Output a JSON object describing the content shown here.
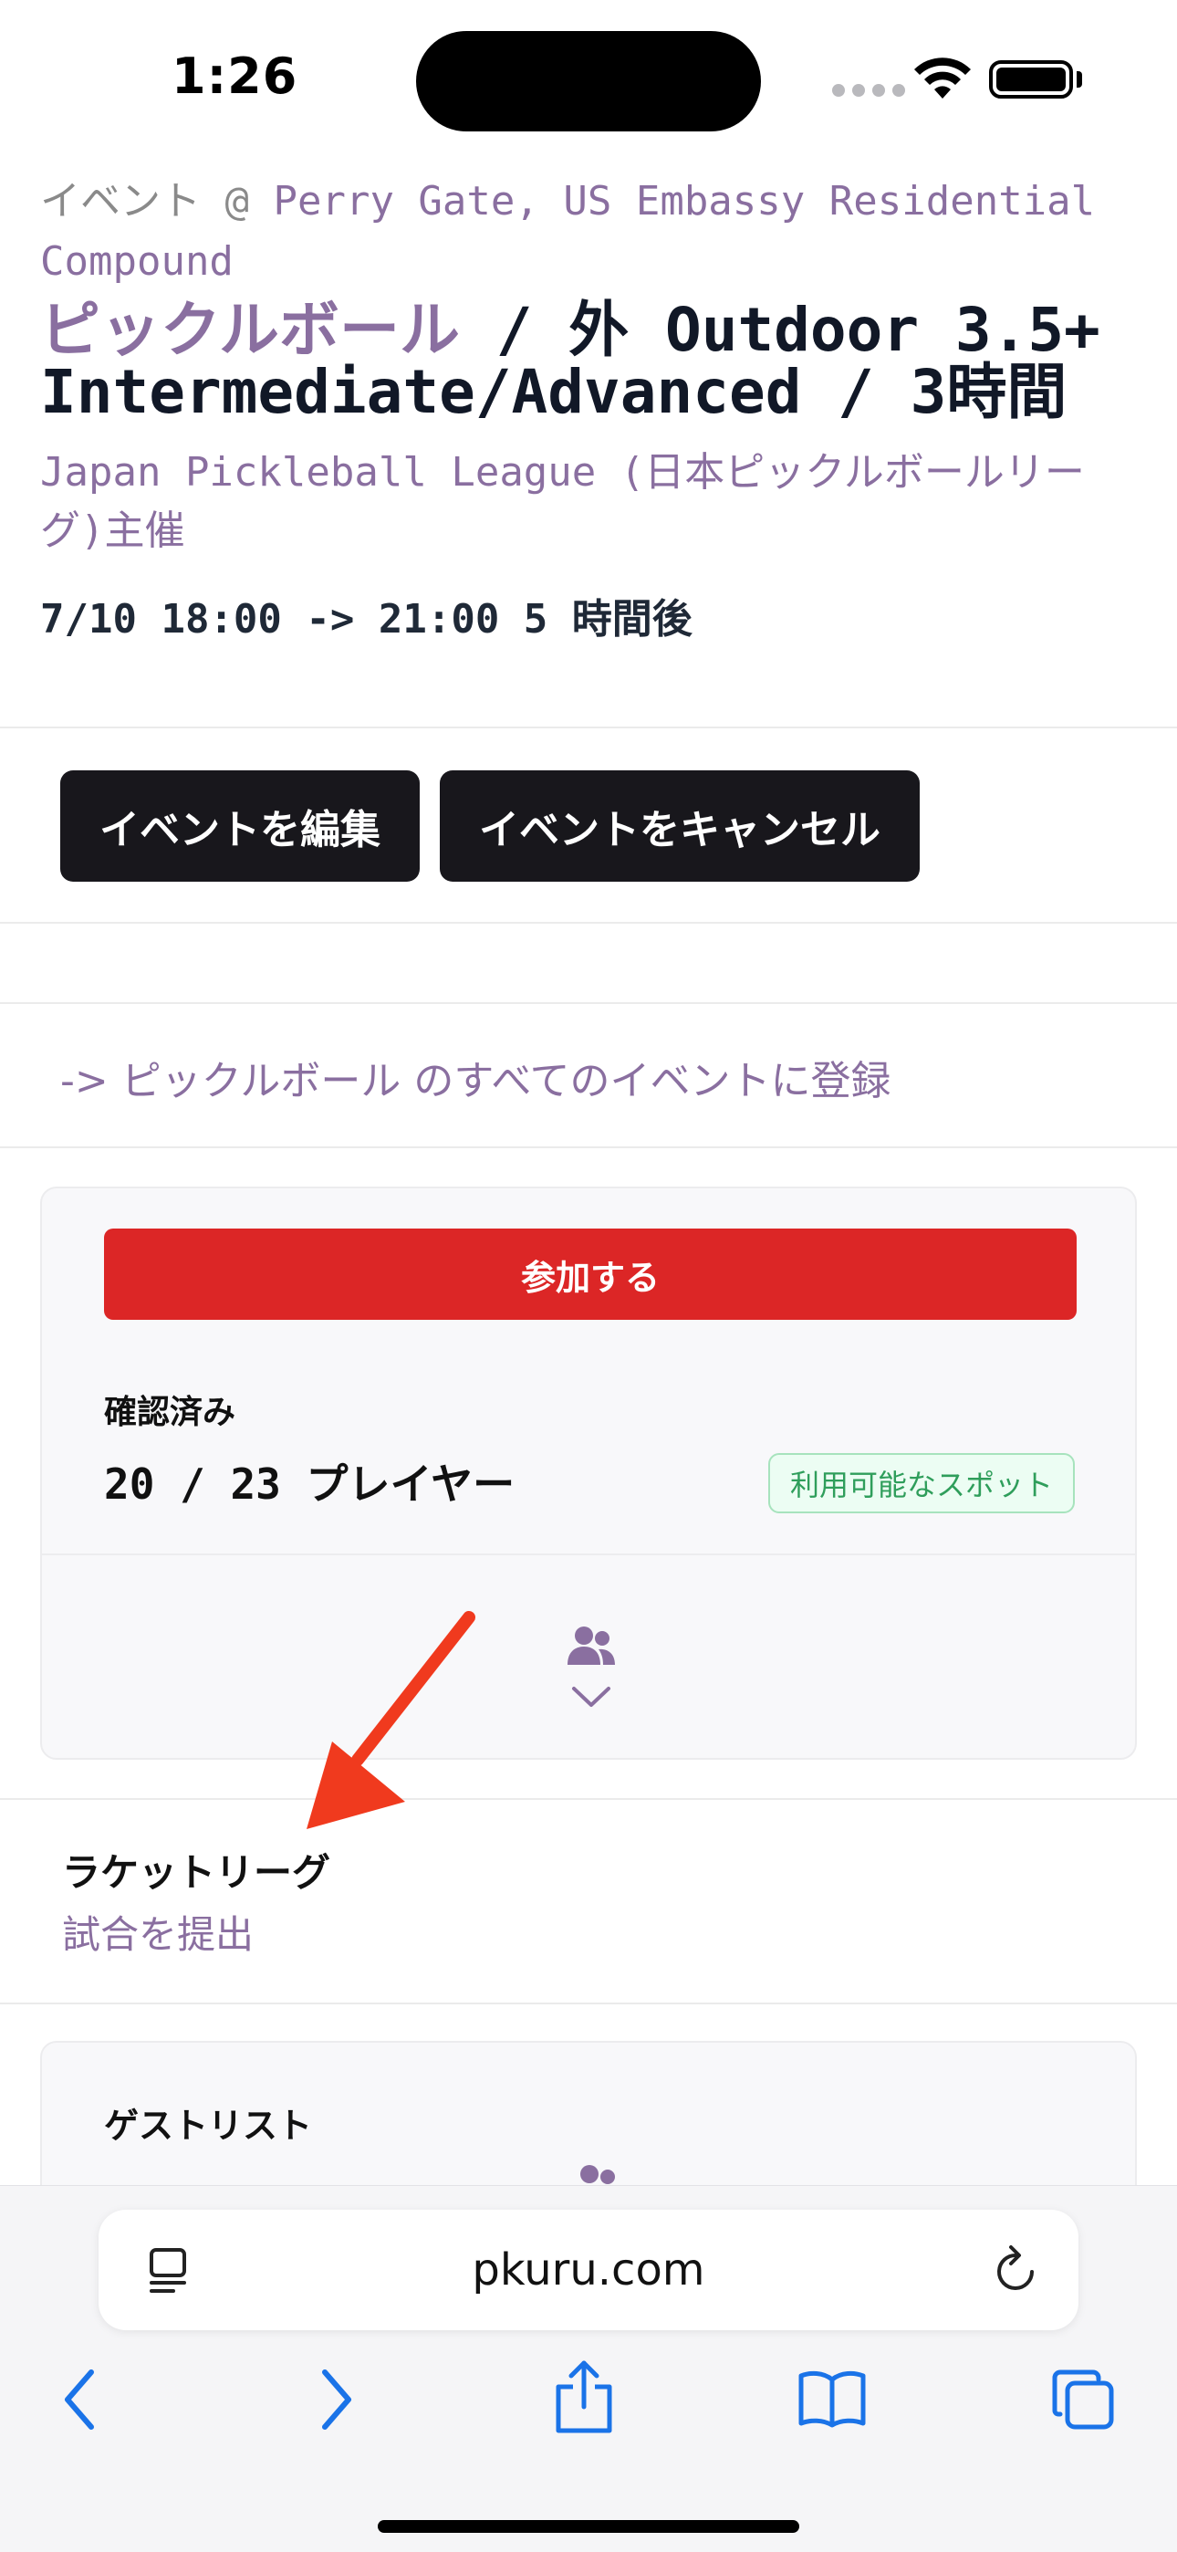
{
  "status_bar": {
    "time": "1:26"
  },
  "event": {
    "venue_prefix": "イベント @ ",
    "venue": "Perry Gate, US Embassy Residential Compound",
    "sport": "ピックルボール",
    "title_rest": " / 外 Outdoor 3.5+ Intermediate/Advanced / 3時間",
    "organizer": "Japan Pickleball League (日本ピックルボールリーグ)主催",
    "datetime": "7/10 18:00 -> 21:00 5 時間後"
  },
  "actions": {
    "edit_label": "イベントを編集",
    "cancel_label": "イベントをキャンセル"
  },
  "subscribe": {
    "label": "-> ピックルボール のすべてのイベントに登録"
  },
  "participation": {
    "join_label": "参加する",
    "confirmed_label": "確認済み",
    "players_text": "20 / 23 プレイヤー",
    "spots_badge": "利用可能なスポット"
  },
  "racket_league": {
    "title": "ラケットリーグ",
    "link": "試合を提出"
  },
  "guest_list": {
    "title": "ゲストリスト"
  },
  "browser": {
    "url": "pkuru.com"
  },
  "colors": {
    "accent_purple": "#8a6fa0",
    "join_red": "#dc2626",
    "dark_button": "#18171c",
    "spots_green": "#2f9e5b",
    "annotation_arrow": "#f03a1e",
    "safari_blue": "#1a73e8"
  },
  "icons": {
    "reader": "reader-mode-icon",
    "reload": "reload-icon",
    "back": "chevron-left-icon",
    "forward": "chevron-right-icon",
    "share": "share-icon",
    "bookmarks": "book-icon",
    "tabs": "tabs-icon"
  }
}
